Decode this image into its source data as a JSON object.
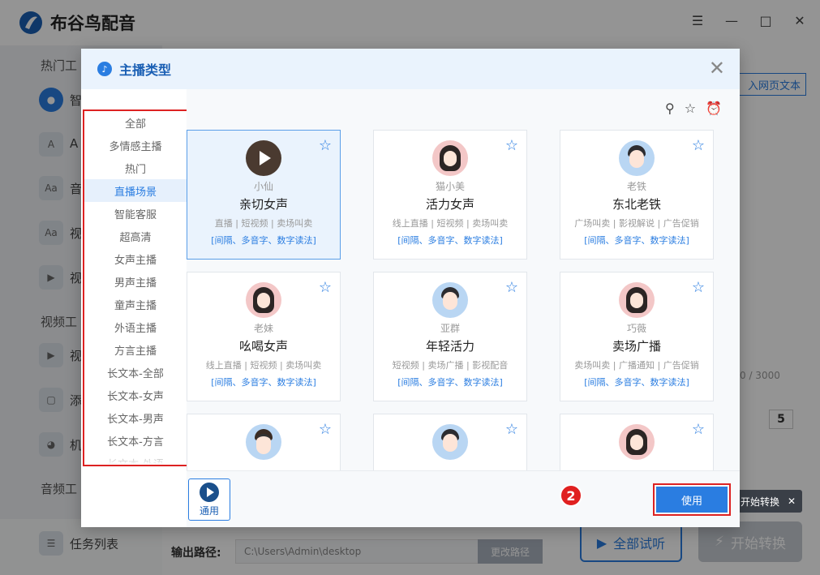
{
  "app": {
    "title": "布谷鸟配音"
  },
  "background": {
    "sidebar": {
      "sections": [
        "热门工",
        "视频工",
        "音频工"
      ],
      "items": [
        "智",
        "A",
        "音",
        "视",
        "视",
        "视",
        "添",
        "机"
      ],
      "task_list": "任务列表"
    },
    "import_button": "入网页文本",
    "char_count": "0 / 3000",
    "number_value": "5",
    "output_label": "输出路径:",
    "output_path": "C:\\Users\\Admin\\desktop",
    "change_path": "更改路径",
    "preview_all": "全部试听",
    "start_convert": "开始转换",
    "tooltip": "开始转换"
  },
  "modal": {
    "title": "主播类型",
    "categories": [
      {
        "label": "全部",
        "active": false
      },
      {
        "label": "多情感主播",
        "active": false
      },
      {
        "label": "热门",
        "active": false
      },
      {
        "label": "直播场景",
        "active": true
      },
      {
        "label": "智能客服",
        "active": false
      },
      {
        "label": "超高清",
        "active": false
      },
      {
        "label": "女声主播",
        "active": false
      },
      {
        "label": "男声主播",
        "active": false
      },
      {
        "label": "童声主播",
        "active": false
      },
      {
        "label": "外语主播",
        "active": false
      },
      {
        "label": "方言主播",
        "active": false
      },
      {
        "label": "长文本-全部",
        "active": false
      },
      {
        "label": "长文本-女声",
        "active": false
      },
      {
        "label": "长文本-男声",
        "active": false
      },
      {
        "label": "长文本-方言",
        "active": false
      },
      {
        "label": "长文本-外语",
        "active": false
      }
    ],
    "voices": [
      {
        "nickname": "小仙",
        "name": "亲切女声",
        "tags": "直播 | 短视频 | 卖场叫卖",
        "features": "[间隔、多音字、数字读法]",
        "avatar": "play",
        "selected": true
      },
      {
        "nickname": "猫小美",
        "name": "活力女声",
        "tags": "线上直播 | 短视频 | 卖场叫卖",
        "features": "[间隔、多音字、数字读法]",
        "avatar": "female",
        "selected": false
      },
      {
        "nickname": "老铁",
        "name": "东北老铁",
        "tags": "广场叫卖 | 影视解说 | 广告促销",
        "features": "[间隔、多音字、数字读法]",
        "avatar": "male",
        "selected": false
      },
      {
        "nickname": "老妹",
        "name": "吆喝女声",
        "tags": "线上直播 | 短视频 | 卖场叫卖",
        "features": "[间隔、多音字、数字读法]",
        "avatar": "female",
        "selected": false
      },
      {
        "nickname": "亚群",
        "name": "年轻活力",
        "tags": "短视频 | 卖场广播 | 影视配音",
        "features": "[间隔、多音字、数字读法]",
        "avatar": "male",
        "selected": false
      },
      {
        "nickname": "巧薇",
        "name": "卖场广播",
        "tags": "卖场叫卖 | 广播通知 | 广告促销",
        "features": "[间隔、多音字、数字读法]",
        "avatar": "female",
        "selected": false
      },
      {
        "nickname": "",
        "name": "",
        "tags": "",
        "features": "",
        "avatar": "glasses",
        "selected": false
      },
      {
        "nickname": "",
        "name": "",
        "tags": "",
        "features": "",
        "avatar": "male",
        "selected": false
      },
      {
        "nickname": "",
        "name": "",
        "tags": "",
        "features": "",
        "avatar": "female",
        "selected": false
      }
    ],
    "general_label": "通用",
    "use_button": "使用",
    "step_badge": "2"
  }
}
